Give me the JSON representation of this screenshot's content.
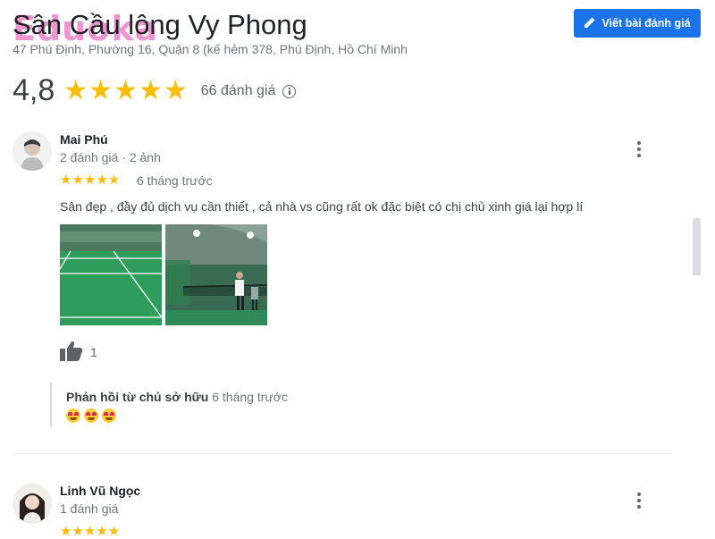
{
  "place": {
    "title": "Sân Cầu lông Vy Phong",
    "address": "47 Phú Định, Phường 16, Quận 8 (kế hẻm 378, Phú Định, Hồ Chí Minh"
  },
  "watermark": "Eduoka",
  "actions": {
    "write_review_label": "Viết bài đánh giá"
  },
  "summary": {
    "rating": "4,8",
    "stars": "★★★★★",
    "review_count": "66 đánh giá"
  },
  "reviews": [
    {
      "author": "Mai Phú",
      "meta": "2 đánh giá · 2 ảnh",
      "stars": "★★★★★",
      "time": "6 tháng trước",
      "text": "Sân đẹp , đầy đủ dịch vụ cần thiết , cả nhà vs cũng rất ok đặc biệt có chị chủ xinh giá lại hợp lí",
      "likes": "1",
      "owner_reply": {
        "label": "Phản hồi từ chủ sở hữu",
        "time": "6 tháng trước",
        "emoji": "heart-eyes-emoji x3"
      }
    },
    {
      "author": "Linh Vũ Ngọc",
      "meta": "1 đánh giá",
      "stars": "★★★★★"
    }
  ],
  "colors": {
    "accent": "#1a73e8",
    "star": "#fbbc04",
    "watermark": "#e040a8"
  },
  "icons": [
    "pencil-icon",
    "info-icon",
    "more-vert-icon",
    "thumbs-up-icon",
    "heart-eyes-emoji"
  ]
}
